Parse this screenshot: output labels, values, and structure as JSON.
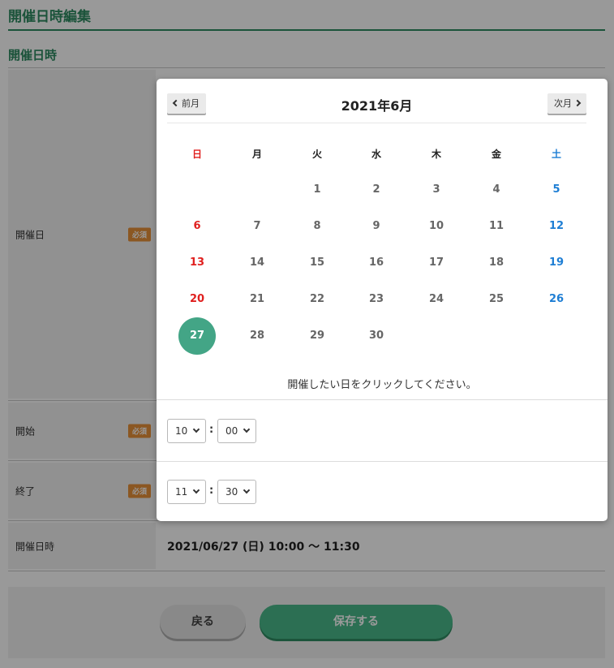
{
  "page": {
    "title": "開催日時編集",
    "section_title": "開催日時",
    "required_badge": "必須",
    "rows": {
      "date_label": "開催日",
      "start_label": "開始",
      "end_label": "終了",
      "datetime_label": "開催日時",
      "datetime_value": "2021/06/27 (日) 10:00 ～ 11:30"
    },
    "buttons": {
      "back": "戻る",
      "save": "保存する"
    }
  },
  "calendar": {
    "prev_label": "前月",
    "next_label": "次月",
    "month_title": "2021年6月",
    "weekdays": [
      "日",
      "月",
      "火",
      "水",
      "木",
      "金",
      "土"
    ],
    "weeks": [
      [
        "",
        "",
        "1",
        "2",
        "3",
        "4",
        "5"
      ],
      [
        "6",
        "7",
        "8",
        "9",
        "10",
        "11",
        "12"
      ],
      [
        "13",
        "14",
        "15",
        "16",
        "17",
        "18",
        "19"
      ],
      [
        "20",
        "21",
        "22",
        "23",
        "24",
        "25",
        "26"
      ],
      [
        "27",
        "28",
        "29",
        "30",
        "",
        "",
        ""
      ]
    ],
    "selected_day": "27",
    "instruction": "開催したい日をクリックしてください。"
  },
  "time": {
    "start": {
      "hour": "10",
      "minute": "00"
    },
    "end": {
      "hour": "11",
      "minute": "30"
    },
    "separator": ":"
  },
  "colors": {
    "accent_green": "#2e8b62",
    "selected_day": "#43a586",
    "sunday": "#e0201f",
    "saturday": "#1e7ed4",
    "required_badge": "#e8913a"
  }
}
